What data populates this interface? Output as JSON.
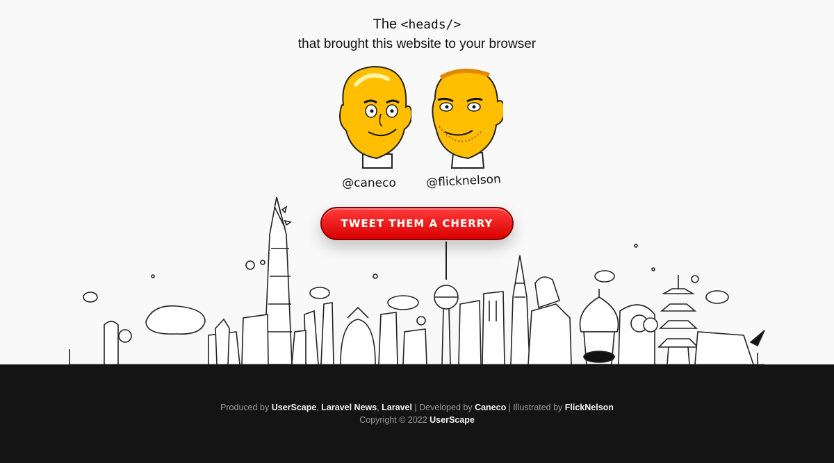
{
  "header": {
    "line1_prefix": "The ",
    "line1_code": "<heads/>",
    "line2": "that brought this website to your browser"
  },
  "credits": [
    {
      "handle": "@caneco"
    },
    {
      "handle": "@flicknelson"
    }
  ],
  "cta": {
    "label": "TWEET THEM A CHERRY"
  },
  "footer": {
    "produced_by_label": "Produced by ",
    "producers": [
      "UserScape",
      "Laravel News",
      "Laravel"
    ],
    "developed_by_label": " | Developed by ",
    "developer": "Caneco",
    "illustrated_by_label": " | Illustrated by ",
    "illustrator": "FlickNelson",
    "copyright_label": "Copyright © 2022 ",
    "copyright_owner": "UserScape"
  },
  "colors": {
    "accent_red": "#e60000",
    "head_yellow": "#ffc400",
    "footer_bg": "#141414"
  }
}
